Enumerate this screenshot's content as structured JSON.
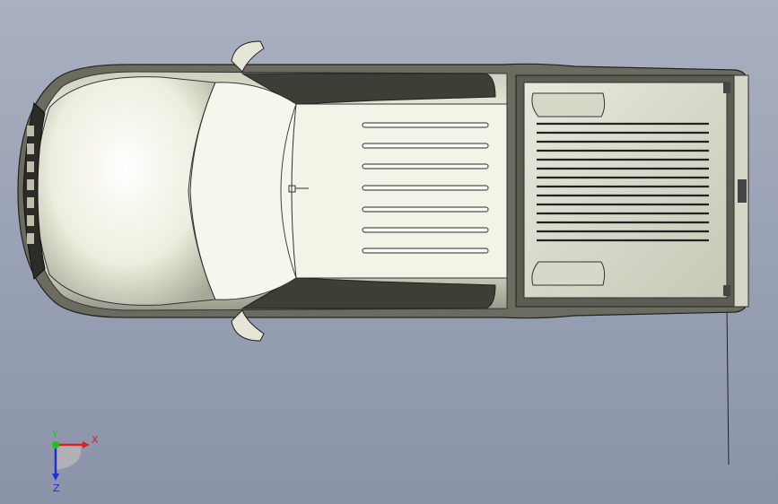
{
  "viewport": {
    "background_top": "#a9b0c0",
    "background_bottom": "#8a93a8"
  },
  "model": {
    "description_icon": "pickup-truck-top-view-icon",
    "body_fill": "#f2f2e6",
    "shadow_fill": "#4a4a42",
    "edge_color": "#2a2a2a"
  },
  "triad": {
    "x_label": "X",
    "y_label": "Y",
    "z_label": "Z",
    "x_color": "#e02020",
    "y_color": "#20c020",
    "z_color": "#2030d0"
  }
}
